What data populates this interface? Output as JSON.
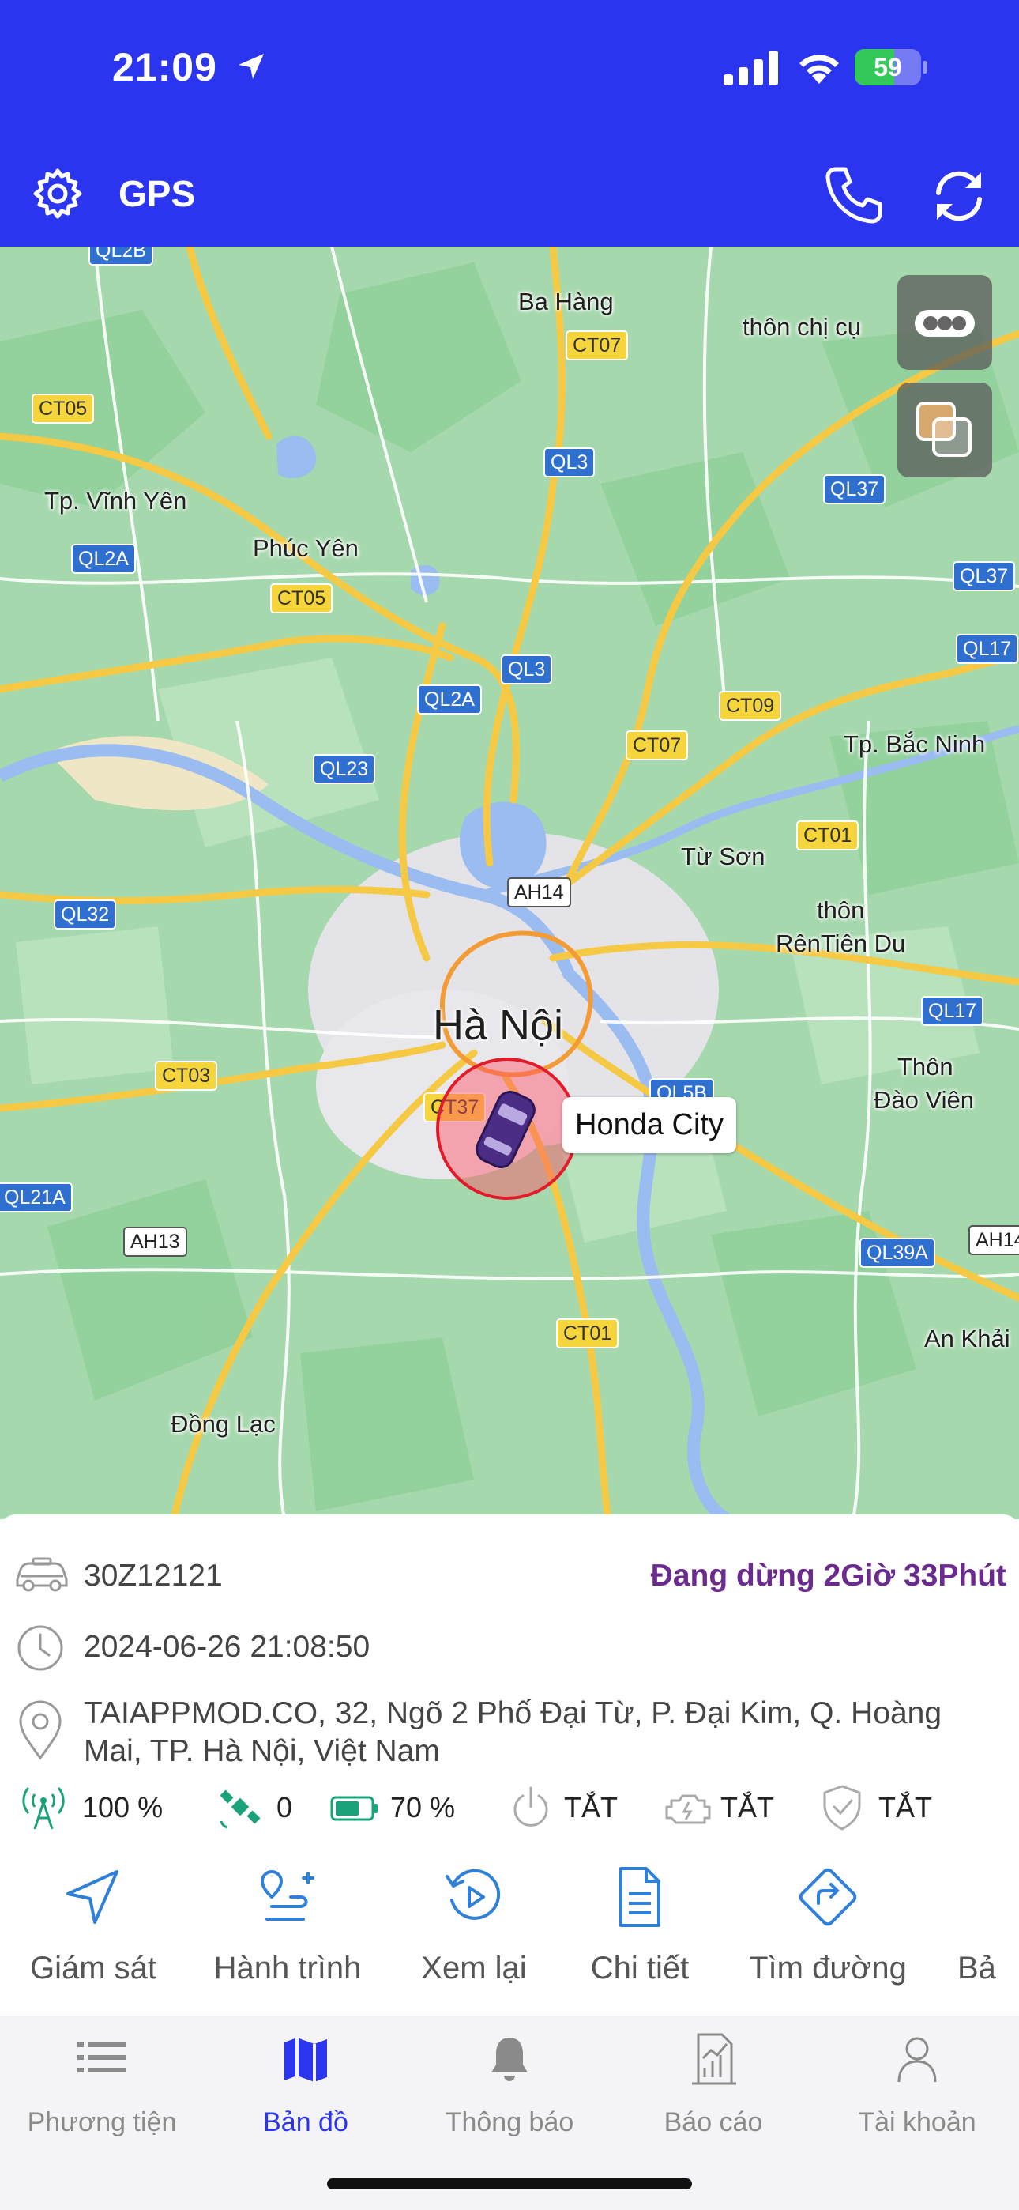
{
  "status_bar": {
    "time": "21:09",
    "battery": "59",
    "battery_level": 0.59
  },
  "header": {
    "title": "GPS",
    "icons": [
      "gear-icon",
      "phone-icon",
      "refresh-icon"
    ]
  },
  "map": {
    "places": [
      "Ba Hàng",
      "thôn chị cụ",
      "Tp. Vĩnh Yên",
      "Phúc Yên",
      "Tp. Bắc Ninh",
      "Từ Sơn",
      "thôn",
      "RênTiên Du",
      "Hà Nội",
      "Thôn",
      "Đào Viên",
      "An Khải",
      "Đồng Lạc"
    ],
    "roads": [
      "QL2B",
      "CT07",
      "CT05",
      "QL3",
      "QL37",
      "QL2A",
      "CT05",
      "QL37",
      "QL17",
      "QL3",
      "QL2A",
      "CT09",
      "CT07",
      "QL23",
      "CT01",
      "AH14",
      "QL32",
      "QL17",
      "CT03",
      "CT37",
      "QL5B",
      "QL21A",
      "AH13",
      "QL39A",
      "AH14",
      "CT01"
    ],
    "vehicle_label": "Honda City",
    "buttons": [
      "more-icon",
      "layers-icon"
    ]
  },
  "vehicle": {
    "plate": "30Z12121",
    "state": "Đang dừng 2Giờ 33Phút",
    "datetime": "2024-06-26 21:08:50",
    "address": "TAIAPPMOD.CO, 32, Ngõ 2 Phố Đại Từ, P. Đại Kim, Q. Hoàng Mai, TP. Hà Nội, Việt Nam"
  },
  "stats": {
    "signal": "100 %",
    "satellites": "0",
    "battery": "70 %",
    "battery_level": 0.7,
    "power": "TẮT",
    "engine": "TẮT",
    "guard": "TẮT"
  },
  "actions": [
    "Giám sát",
    "Hành trình",
    "Xem lại",
    "Chi tiết",
    "Tìm đường",
    "Bả"
  ],
  "tabs": [
    {
      "label": "Phương tiện",
      "active": false
    },
    {
      "label": "Bản đồ",
      "active": true
    },
    {
      "label": "Thông báo",
      "active": false
    },
    {
      "label": "Báo cáo",
      "active": false
    },
    {
      "label": "Tài khoản",
      "active": false
    }
  ],
  "colors": {
    "primary": "#2b35f0",
    "state": "#6b2a8e",
    "action": "#2f80d8",
    "map_green": "#a6d8ad",
    "road": "#f6c945"
  }
}
